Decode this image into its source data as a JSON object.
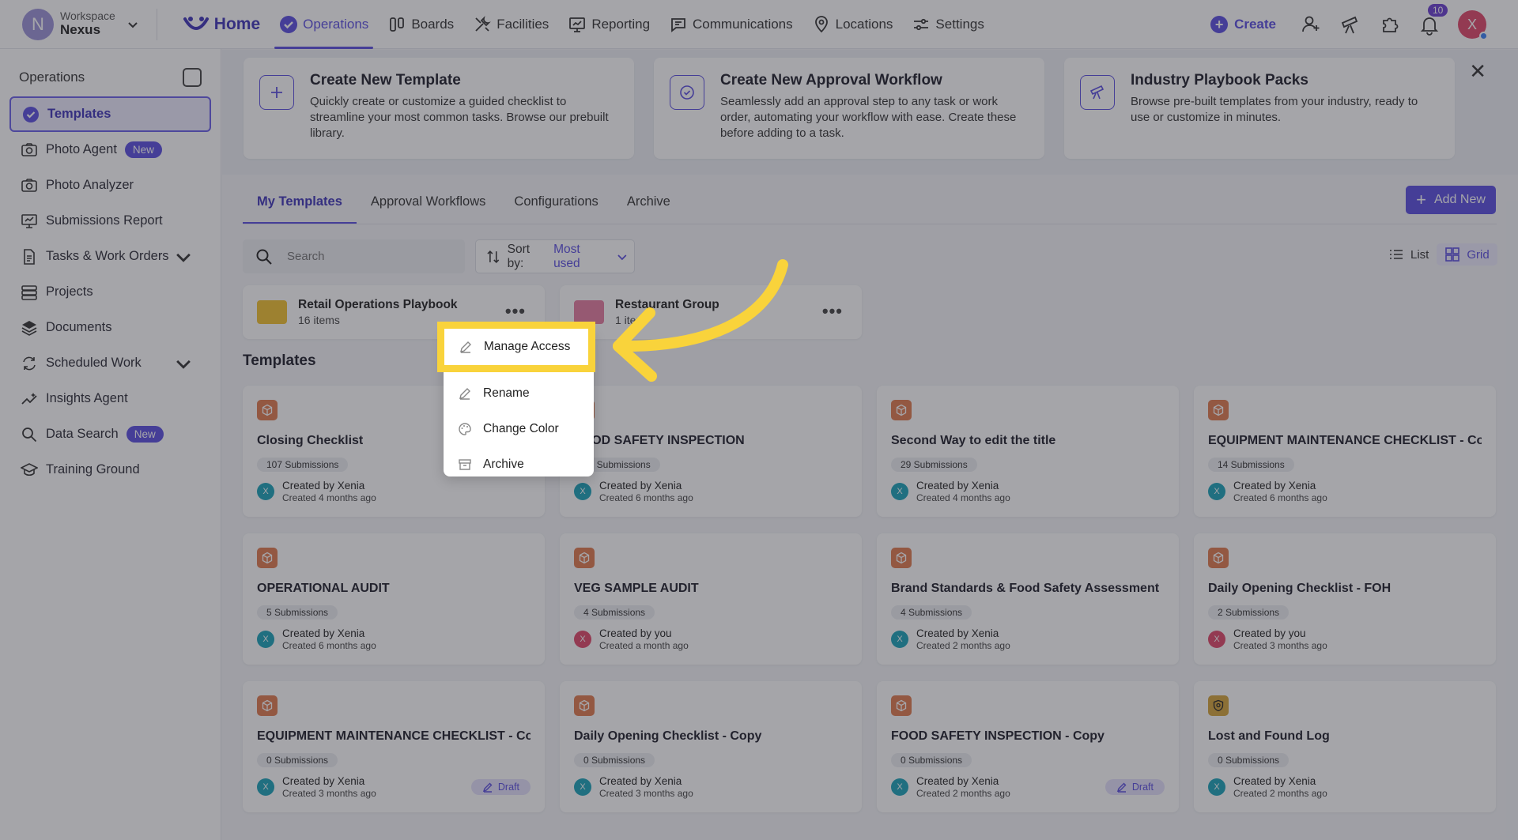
{
  "workspace": {
    "avatar_letter": "N",
    "label": "Workspace",
    "name": "Nexus"
  },
  "nav": {
    "home": "Home",
    "items": [
      "Operations",
      "Boards",
      "Facilities",
      "Reporting",
      "Communications",
      "Locations",
      "Settings"
    ]
  },
  "topbar": {
    "create": "Create",
    "notifications": "10",
    "user_letter": "X"
  },
  "sidebar": {
    "title": "Operations",
    "items": [
      {
        "label": "Templates"
      },
      {
        "label": "Photo Agent",
        "badge": "New"
      },
      {
        "label": "Photo Analyzer"
      },
      {
        "label": "Submissions Report"
      },
      {
        "label": "Tasks & Work Orders"
      },
      {
        "label": "Projects"
      },
      {
        "label": "Documents"
      },
      {
        "label": "Scheduled Work"
      },
      {
        "label": "Insights Agent"
      },
      {
        "label": "Data Search",
        "badge": "New"
      },
      {
        "label": "Training Ground"
      }
    ]
  },
  "promos": [
    {
      "title": "Create New Template",
      "desc": "Quickly create or customize a guided checklist to streamline your most common tasks. Browse our prebuilt library."
    },
    {
      "title": "Create New Approval Workflow",
      "desc": "Seamlessly add an approval step to any task or work order, automating your workflow with ease. Create these before adding to a task."
    },
    {
      "title": "Industry Playbook Packs",
      "desc": "Browse pre-built templates from your industry, ready to use or customize in minutes."
    }
  ],
  "tabs": [
    "My Templates",
    "Approval Workflows",
    "Configurations",
    "Archive"
  ],
  "add_new": "Add New",
  "search": {
    "placeholder": "Search"
  },
  "sort": {
    "label": "Sort by:",
    "value": "Most used"
  },
  "view": {
    "list": "List",
    "grid": "Grid"
  },
  "folders": [
    {
      "name": "Retail Operations Playbook",
      "count": "16 items",
      "color": "#f2c230"
    },
    {
      "name": "Restaurant Group",
      "count": "1 item",
      "color": "#e67ca0"
    }
  ],
  "section_title": "Templates",
  "templates": [
    {
      "title": "Closing Checklist",
      "subs": "107 Submissions",
      "by": "Created by Xenia",
      "when": "Created 4 months ago"
    },
    {
      "title": "FOOD SAFETY INSPECTION",
      "subs": "40 Submissions",
      "by": "Created by Xenia",
      "when": "Created 6 months ago"
    },
    {
      "title": "Second Way to edit the title",
      "subs": "29 Submissions",
      "by": "Created by Xenia",
      "when": "Created 4 months ago"
    },
    {
      "title": "EQUIPMENT MAINTENANCE CHECKLIST - Copy",
      "subs": "14 Submissions",
      "by": "Created by Xenia",
      "when": "Created 6 months ago"
    },
    {
      "title": "OPERATIONAL AUDIT",
      "subs": "5 Submissions",
      "by": "Created by Xenia",
      "when": "Created 6 months ago"
    },
    {
      "title": "VEG SAMPLE AUDIT",
      "subs": "4 Submissions",
      "by": "Created by you",
      "when": "Created a month ago"
    },
    {
      "title": "Brand Standards & Food Safety Assessment",
      "subs": "4 Submissions",
      "by": "Created by Xenia",
      "when": "Created 2 months ago"
    },
    {
      "title": "Daily Opening Checklist - FOH",
      "subs": "2 Submissions",
      "by": "Created by you",
      "when": "Created 3 months ago"
    },
    {
      "title": "EQUIPMENT MAINTENANCE CHECKLIST - Copy",
      "subs": "0 Submissions",
      "by": "Created by Xenia",
      "when": "Created 3 months ago",
      "draft": "Draft"
    },
    {
      "title": "Daily Opening Checklist - Copy",
      "subs": "0 Submissions",
      "by": "Created by Xenia",
      "when": "Created 3 months ago"
    },
    {
      "title": "FOOD SAFETY INSPECTION - Copy",
      "subs": "0 Submissions",
      "by": "Created by Xenia",
      "when": "Created 2 months ago",
      "draft": "Draft"
    },
    {
      "title": "Lost and Found Log",
      "subs": "0 Submissions",
      "by": "Created by Xenia",
      "when": "Created 2 months ago"
    }
  ],
  "context_menu": [
    "Manage Access",
    "Rename",
    "Change Color",
    "Archive"
  ],
  "colors": {
    "accent": "#5a4ee0",
    "highlight": "#f9d33b",
    "template_icon": "#e07a4f"
  }
}
